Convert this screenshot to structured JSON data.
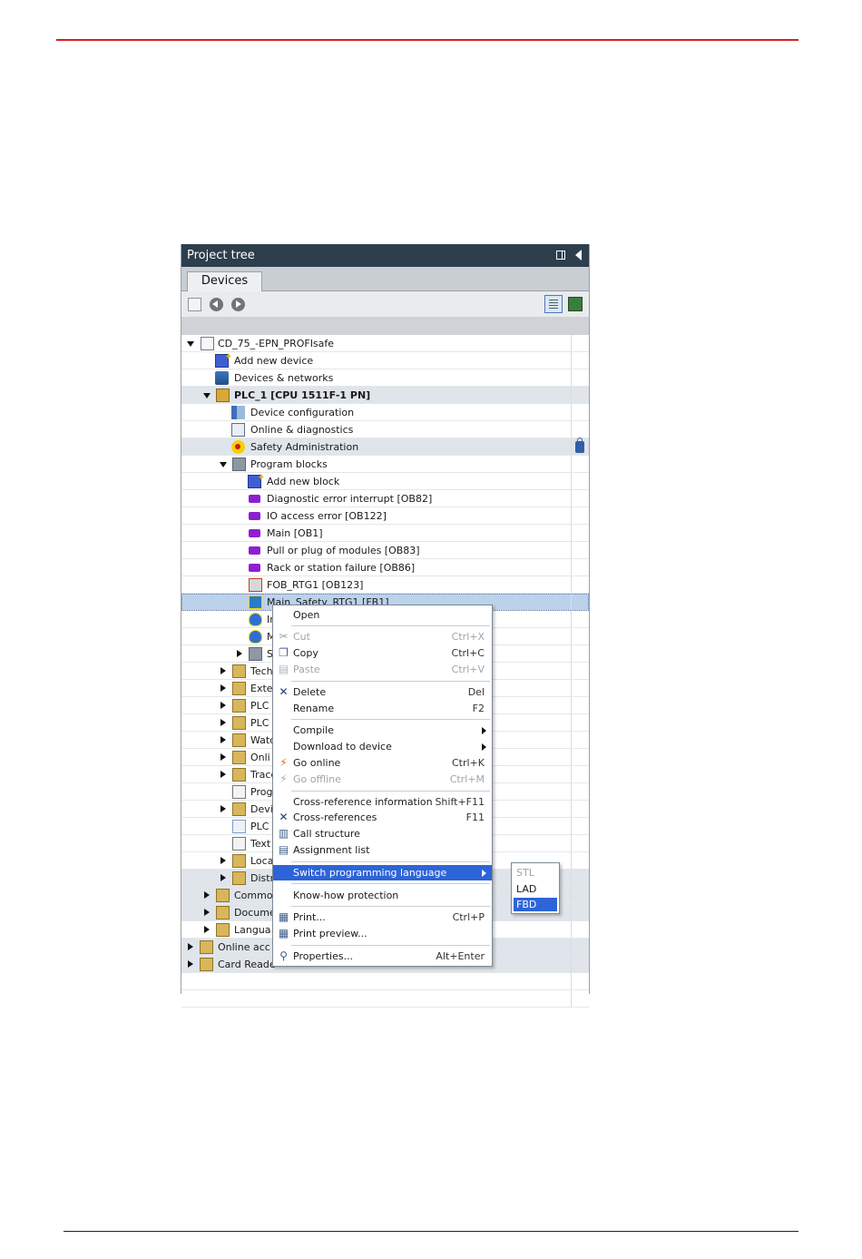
{
  "panel": {
    "title": "Project tree",
    "tab": "Devices"
  },
  "tree": {
    "project": "CD_75_-EPN_PROFIsafe",
    "add_new_device": "Add new device",
    "devices_networks": "Devices & networks",
    "plc": "PLC_1 [CPU 1511F-1 PN]",
    "device_configuration": "Device configuration",
    "online_diagnostics": "Online & diagnostics",
    "safety_administration": "Safety Administration",
    "program_blocks": "Program blocks",
    "add_new_block": "Add new block",
    "ob82": "Diagnostic error interrupt [OB82]",
    "ob122": "IO access error [OB122]",
    "ob1": "Main [OB1]",
    "ob83": "Pull or plug of modules [OB83]",
    "ob86": "Rack or station failure [OB86]",
    "ob123": "FOB_RTG1 [OB123]",
    "fb1": "Main_Safety_RTG1 [FB1]",
    "db_in": "In",
    "db_m": "M",
    "sys": "S",
    "tech": "Tech",
    "ext": "Exte",
    "plc_tags": "PLC t",
    "plc_data": "PLC c",
    "watch": "Watc",
    "online_backup": "Onli",
    "traces": "Trace",
    "program_info": "Prog",
    "device_proxy": "Devi",
    "plc_alarms": "PLC a",
    "text_lists": "Text",
    "local_modules": "Loca",
    "distributed_io": "Distr",
    "common_data": "Commo",
    "documentation": "Docume",
    "languages": "Langua",
    "online_access": "Online acc",
    "card_reader": "Card Reade"
  },
  "menu": {
    "open": "Open",
    "cut": "Cut",
    "cut_sc": "Ctrl+X",
    "copy": "Copy",
    "copy_sc": "Ctrl+C",
    "paste": "Paste",
    "paste_sc": "Ctrl+V",
    "delete": "Delete",
    "delete_sc": "Del",
    "rename": "Rename",
    "rename_sc": "F2",
    "compile": "Compile",
    "download": "Download to device",
    "go_online": "Go online",
    "go_online_sc": "Ctrl+K",
    "go_offline": "Go offline",
    "go_offline_sc": "Ctrl+M",
    "xref_info": "Cross-reference information",
    "xref_info_sc": "Shift+F11",
    "xrefs": "Cross-references",
    "xrefs_sc": "F11",
    "call_structure": "Call structure",
    "assignment_list": "Assignment list",
    "switch_lang": "Switch programming language",
    "knowhow": "Know-how protection",
    "print": "Print...",
    "print_sc": "Ctrl+P",
    "print_preview": "Print preview...",
    "properties": "Properties...",
    "properties_sc": "Alt+Enter"
  },
  "submenu": {
    "stl": "STL",
    "lad": "LAD",
    "fbd": "FBD"
  },
  "colors": {
    "header_bg": "#2d3e4d",
    "accent_rule": "#d42121",
    "highlight": "#2d64d8"
  }
}
